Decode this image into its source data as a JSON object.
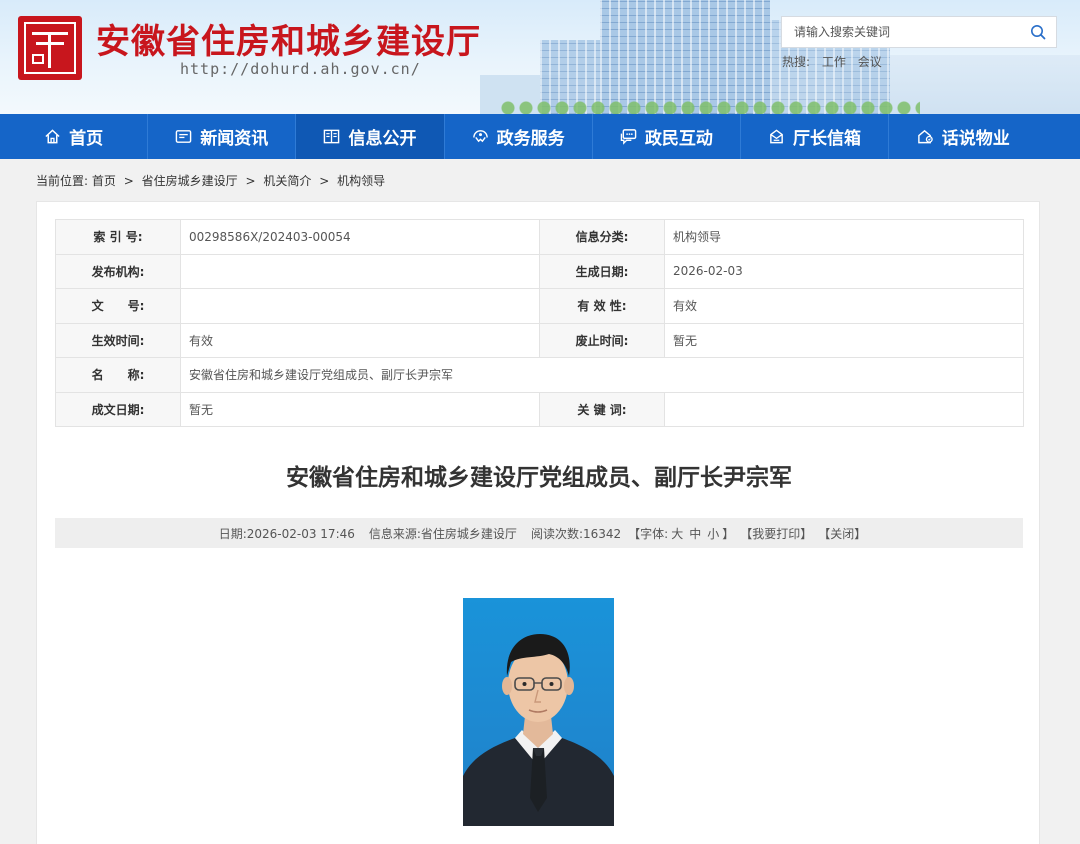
{
  "header": {
    "site_title": "安徽省住房和城乡建设厅",
    "site_url": "http://dohurd.ah.gov.cn/",
    "search": {
      "placeholder": "请输入搜索关键词"
    },
    "hot": {
      "label": "热搜:",
      "keywords": [
        "工作",
        "会议"
      ]
    }
  },
  "nav": {
    "items": [
      {
        "label": "首页",
        "icon": "home-icon"
      },
      {
        "label": "新闻资讯",
        "icon": "news-icon"
      },
      {
        "label": "信息公开",
        "icon": "book-icon",
        "active": true
      },
      {
        "label": "政务服务",
        "icon": "service-icon"
      },
      {
        "label": "政民互动",
        "icon": "chat-icon"
      },
      {
        "label": "厅长信箱",
        "icon": "mailbox-icon"
      },
      {
        "label": "话说物业",
        "icon": "property-icon"
      }
    ]
  },
  "breadcrumb": {
    "prefix": "当前位置:",
    "items": [
      "首页",
      "省住房城乡建设厅",
      "机关简介",
      "机构领导"
    ],
    "separator": ">"
  },
  "info_table": {
    "rows": [
      [
        {
          "label": "索 引 号:",
          "value": "00298586X/202403-00054"
        },
        {
          "label": "信息分类:",
          "value": "机构领导"
        }
      ],
      [
        {
          "label": "发布机构:",
          "value": ""
        },
        {
          "label": "生成日期:",
          "value": "2026-02-03"
        }
      ],
      [
        {
          "label": "文　　号:",
          "value": ""
        },
        {
          "label": "有 效 性:",
          "value": "有效"
        }
      ],
      [
        {
          "label": "生效时间:",
          "value": "有效"
        },
        {
          "label": "废止时间:",
          "value": "暂无"
        }
      ],
      [
        {
          "label": "名　　称:",
          "value": "安徽省住房和城乡建设厅党组成员、副厅长尹宗军"
        }
      ],
      [
        {
          "label": "成文日期:",
          "value": "暂无"
        },
        {
          "label": "关 键 词:",
          "value": ""
        }
      ]
    ]
  },
  "article": {
    "title": "安徽省住房和城乡建设厅党组成员、副厅长尹宗军",
    "meta": {
      "date": "日期:2026-02-03 17:46",
      "source": "信息来源:省住房城乡建设厅",
      "views": "阅读次数:16342",
      "font_open": "【字体:",
      "font_large": "大",
      "font_medium": "中",
      "font_small": "小",
      "font_close": "】",
      "print": "【我要打印】",
      "close": "【关闭】"
    }
  },
  "colors": {
    "brand_red": "#c8161d",
    "nav_blue": "#1565c8",
    "nav_active": "#0f58b4",
    "portrait_bg": "#1a93d9"
  }
}
